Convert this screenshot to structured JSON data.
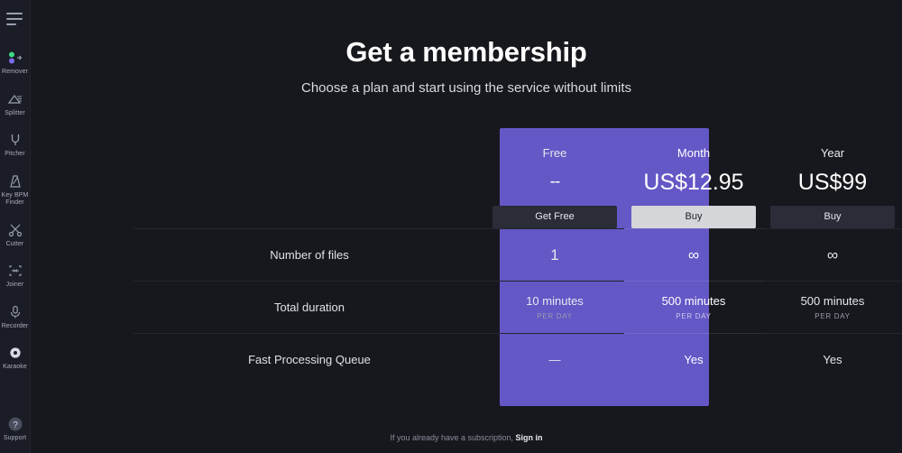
{
  "sidebar": {
    "menu_icon": "hamburger-icon",
    "items": [
      {
        "label": "Remover",
        "icon": "vocal-remover-icon"
      },
      {
        "label": "Splitter",
        "icon": "splitter-icon"
      },
      {
        "label": "Pitcher",
        "icon": "pitcher-tuning-fork-icon"
      },
      {
        "label": "Key BPM Finder",
        "icon": "metronome-icon"
      },
      {
        "label": "Cutter",
        "icon": "scissors-icon"
      },
      {
        "label": "Joiner",
        "icon": "joiner-brackets-icon"
      },
      {
        "label": "Recorder",
        "icon": "microphone-icon"
      },
      {
        "label": "Karaoke",
        "icon": "karaoke-disc-icon"
      }
    ],
    "support": {
      "label": "Support",
      "icon": "question-mark-icon"
    }
  },
  "header": {
    "title": "Get a membership",
    "subtitle": "Choose a plan and start using the service without limits"
  },
  "plans": [
    {
      "name": "Free",
      "price": "--",
      "cta": "Get Free",
      "highlighted": false
    },
    {
      "name": "Month",
      "price": "US$12.95",
      "cta": "Buy",
      "highlighted": true
    },
    {
      "name": "Year",
      "price": "US$99",
      "cta": "Buy",
      "highlighted": false
    }
  ],
  "features": [
    {
      "label": "Number of files",
      "values": [
        {
          "main": "1",
          "sub": ""
        },
        {
          "main": "∞",
          "sub": ""
        },
        {
          "main": "∞",
          "sub": ""
        }
      ]
    },
    {
      "label": "Total duration",
      "values": [
        {
          "main": "10 minutes",
          "sub": "PER DAY"
        },
        {
          "main": "500 minutes",
          "sub": "PER DAY"
        },
        {
          "main": "500 minutes",
          "sub": "PER DAY"
        }
      ]
    },
    {
      "label": "Fast Processing Queue",
      "values": [
        {
          "main": "—",
          "sub": ""
        },
        {
          "main": "Yes",
          "sub": ""
        },
        {
          "main": "Yes",
          "sub": ""
        }
      ]
    }
  ],
  "footer": {
    "text": "If you already have a subscription,",
    "link": "Sign in"
  },
  "colors": {
    "background": "#17181d",
    "sidebar": "#1b1d26",
    "accent": "#6457c6",
    "button_dark": "#2a2c38",
    "button_light": "#d5d6da",
    "divider": "#24262f"
  }
}
